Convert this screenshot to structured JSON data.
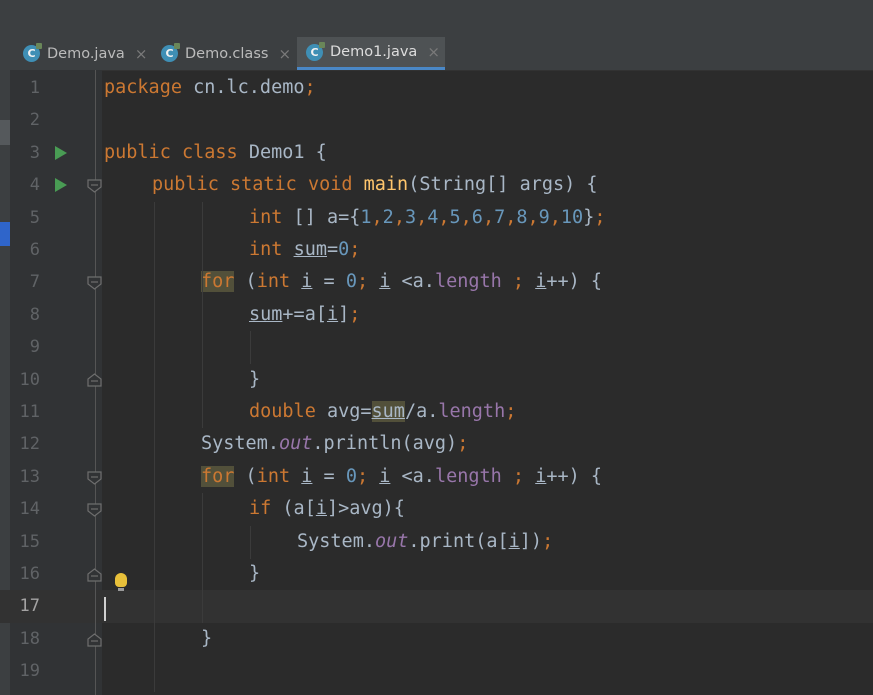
{
  "tabs": [
    {
      "label": "Demo.java",
      "icon": "java-class-icon",
      "active": false
    },
    {
      "label": "Demo.class",
      "icon": "java-class-icon",
      "active": false
    },
    {
      "label": "Demo1.java",
      "icon": "java-class-icon",
      "active": true
    }
  ],
  "tab_icon_letter": "C",
  "close_glyph": "×",
  "line_numbers": [
    "1",
    "2",
    "3",
    "4",
    "5",
    "6",
    "7",
    "8",
    "9",
    "10",
    "11",
    "12",
    "13",
    "14",
    "15",
    "16",
    "17",
    "18",
    "19"
  ],
  "current_line": "17",
  "colors": {
    "editor_bg": "#2b2b2b",
    "gutter_bg": "#313335",
    "keyword": "#cc7832",
    "number": "#6897bb",
    "method": "#ffc66d",
    "field": "#9876aa",
    "text": "#a9b7c6",
    "run_icon": "#499c54",
    "bulb": "#e8c03a"
  },
  "code": {
    "l1_kw": "package",
    "l1_pkg": " cn.lc.demo",
    "semicolon": ";",
    "l3_public": "public",
    "l3_class": "class",
    "l3_name": "Demo1",
    "l3_brace": " {",
    "l4_public": "public",
    "l4_static": "static",
    "l4_void": "void",
    "l4_main": "main",
    "l4_params": "(String[] args) {",
    "l5_int": "int",
    "l5_decl": " [] a={",
    "l5_values": [
      "1",
      "2",
      "3",
      "4",
      "5",
      "6",
      "7",
      "8",
      "9",
      "10"
    ],
    "comma": ",",
    "l5_close": "}",
    "l6_int": "int",
    "l6_sum": "sum",
    "l6_eq": "=",
    "l6_zero": "0",
    "for_kw": "for",
    "for_paren": " (",
    "for_int": "int",
    "for_i": "i",
    "for_assign": " = ",
    "for_zero": "0",
    "for_semi1": "; ",
    "for_i2": "i",
    "for_lt": " <a.",
    "length": "length",
    "for_semi2": " ; ",
    "for_i3": "i",
    "for_inc": "++) {",
    "l8_sum": "sum",
    "l8_mid": "+=a[",
    "l8_i": "i",
    "l8_close": "]",
    "brace_close": "}",
    "l11_double": "double",
    "l11_avg": " avg=",
    "l11_sum": "sum",
    "l11_div": "/a.",
    "l11_length": "length",
    "l12_sys": "System.",
    "out": "out",
    "l12_call": ".println(avg)",
    "l14_if": "if",
    "l14_open": " (a[",
    "l14_i": "i",
    "l14_rest": "]>avg){",
    "l15_sys": "System.",
    "l15_call": ".print(a[",
    "l15_i": "i",
    "l15_close": "])"
  }
}
